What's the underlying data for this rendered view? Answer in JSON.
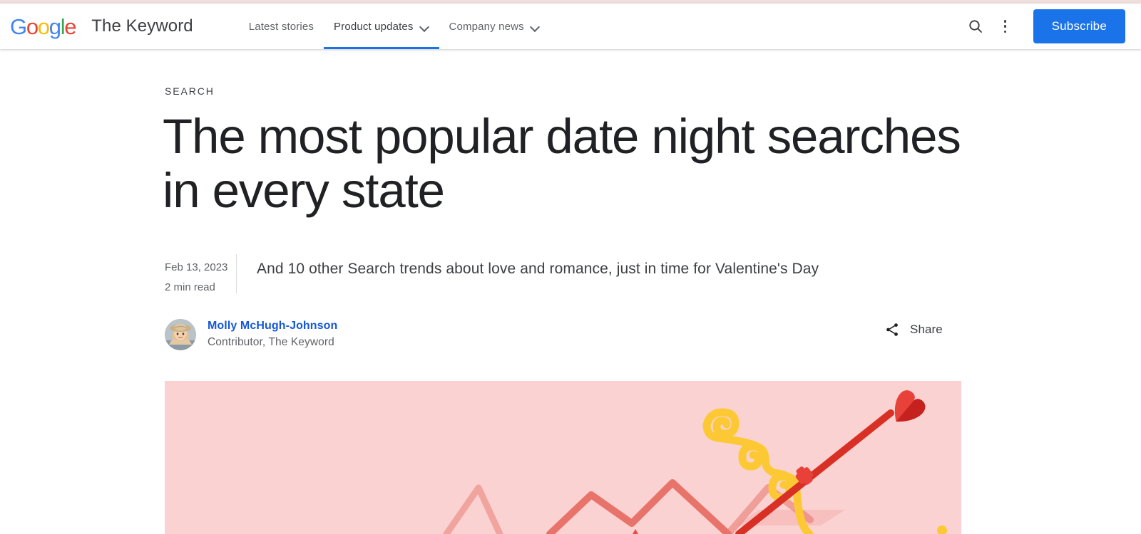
{
  "header": {
    "logo": {
      "icon": "google-logo",
      "letters": [
        {
          "char": "G",
          "color": "#4285F4"
        },
        {
          "char": "o",
          "color": "#EA4335"
        },
        {
          "char": "o",
          "color": "#FBBC05"
        },
        {
          "char": "g",
          "color": "#4285F4"
        },
        {
          "char": "l",
          "color": "#34A853"
        },
        {
          "char": "e",
          "color": "#EA4335"
        }
      ]
    },
    "brand_name": "The Keyword",
    "nav": [
      {
        "label": "Latest stories",
        "has_dropdown": false,
        "active": false
      },
      {
        "label": "Product updates",
        "has_dropdown": true,
        "active": true
      },
      {
        "label": "Company news",
        "has_dropdown": true,
        "active": false
      }
    ],
    "search_icon": "search-icon",
    "overflow_icon": "more-vertical-icon",
    "subscribe_label": "Subscribe",
    "accent_color": "#1a73e8",
    "active_underline_color": "#1a73e8"
  },
  "article": {
    "kicker": "SEARCH",
    "headline": "The most popular date night searches in every state",
    "date": "Feb 13, 2023",
    "read_time": "2 min read",
    "subtitle": "And 10 other Search trends about love and romance, just in time for Valentine's Day",
    "author": {
      "name": "Molly McHugh-Johnson",
      "role": "Contributor, The Keyword",
      "avatar_alt": "avatar-photo",
      "name_color": "#1558d6"
    },
    "share": {
      "label": "Share",
      "icon": "share-icon"
    },
    "hero": {
      "alt": "hero-illustration-cupid-bow-arrow-chart",
      "background_color": "#fad2d1",
      "chart_line_color": "#e8736a",
      "bow_color": "#fcc934",
      "arrow_color": "#d93025",
      "heart_color": "#e8413a",
      "string_color": "#ffffff"
    }
  }
}
